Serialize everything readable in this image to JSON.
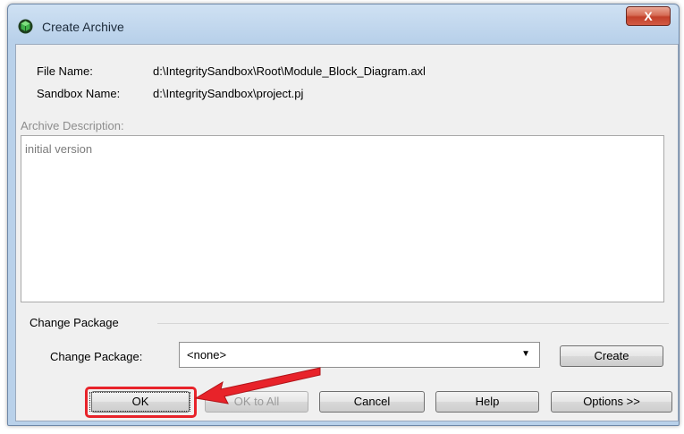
{
  "window": {
    "title": "Create Archive",
    "close_label": "X"
  },
  "info": {
    "file_name_label": "File Name:",
    "file_name_value": "d:\\IntegritySandbox\\Root\\Module_Block_Diagram.axl",
    "sandbox_name_label": "Sandbox Name:",
    "sandbox_name_value": "d:\\IntegritySandbox\\project.pj"
  },
  "description": {
    "label": "Archive Description:",
    "value": "initial version"
  },
  "change_package": {
    "section_title": "Change Package",
    "field_label": "Change Package:",
    "selected": "<none>",
    "create_label": "Create"
  },
  "buttons": {
    "ok": "OK",
    "ok_to_all": "OK to All",
    "cancel": "Cancel",
    "help": "Help",
    "options": "Options >>"
  },
  "colors": {
    "highlight": "#e8232a",
    "title_bar": "#b9d1ea",
    "dialog_bg": "#f0f0f0"
  },
  "icons": {
    "app": "green-cube-icon",
    "close": "close-icon",
    "dropdown": "chevron-down-icon",
    "annotation": "red-arrow"
  }
}
